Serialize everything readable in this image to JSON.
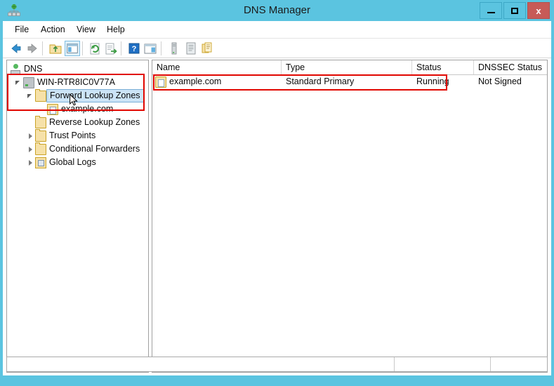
{
  "window": {
    "title": "DNS Manager",
    "app_icon": "dns-icon",
    "controls": {
      "minimize": "–",
      "maximize": "□",
      "close": "x"
    },
    "accent_color": "#5BC4E0",
    "close_color": "#C75B57"
  },
  "menubar": {
    "items": [
      {
        "label": "File"
      },
      {
        "label": "Action"
      },
      {
        "label": "View"
      },
      {
        "label": "Help"
      }
    ]
  },
  "toolbar": {
    "buttons": [
      {
        "name": "back-icon"
      },
      {
        "name": "forward-icon"
      },
      {
        "name": "up-folder-icon"
      },
      {
        "name": "show-hide-console-tree-icon"
      },
      {
        "name": "refresh-icon"
      },
      {
        "name": "export-list-icon"
      },
      {
        "name": "help-icon"
      },
      {
        "name": "show-hide-action-pane-icon"
      },
      {
        "name": "new-server-icon"
      },
      {
        "name": "properties-icon"
      },
      {
        "name": "copy-icon"
      }
    ]
  },
  "tree": {
    "nodes": [
      {
        "label": "DNS",
        "icon": "dns-root-icon",
        "indent": 0,
        "expander": "none",
        "selected": false
      },
      {
        "label": "WIN-RTR8IC0V77A",
        "icon": "server-icon",
        "indent": 1,
        "expander": "open",
        "selected": false
      },
      {
        "label": "Forward Lookup Zones",
        "icon": "folder-icon",
        "indent": 2,
        "expander": "open",
        "selected": true
      },
      {
        "label": "example.com",
        "icon": "zone-icon",
        "indent": 3,
        "expander": "none",
        "selected": false
      },
      {
        "label": "Reverse Lookup Zones",
        "icon": "folder-icon",
        "indent": 2,
        "expander": "none",
        "selected": false
      },
      {
        "label": "Trust Points",
        "icon": "folder-icon",
        "indent": 2,
        "expander": "closed",
        "selected": false
      },
      {
        "label": "Conditional Forwarders",
        "icon": "folder-icon",
        "indent": 2,
        "expander": "closed",
        "selected": false
      },
      {
        "label": "Global Logs",
        "icon": "global-logs-icon",
        "indent": 2,
        "expander": "closed",
        "selected": false
      }
    ]
  },
  "list": {
    "columns": [
      {
        "label": "Name"
      },
      {
        "label": "Type"
      },
      {
        "label": "Status"
      },
      {
        "label": "DNSSEC Status"
      }
    ],
    "rows": [
      {
        "icon": "zone-icon",
        "name": "example.com",
        "type": "Standard Primary",
        "status": "Running",
        "dnssec_status": "Not Signed"
      }
    ],
    "scrollbar": {
      "left_arrow": "‹",
      "right_arrow": "›",
      "grip": "‖‖"
    }
  },
  "statusbar": {
    "panes": [
      "",
      "",
      ""
    ]
  },
  "annotations": {
    "color": "#E10600",
    "boxes": [
      {
        "name": "tree-highlight-box"
      },
      {
        "name": "list-row-highlight-box"
      }
    ]
  }
}
